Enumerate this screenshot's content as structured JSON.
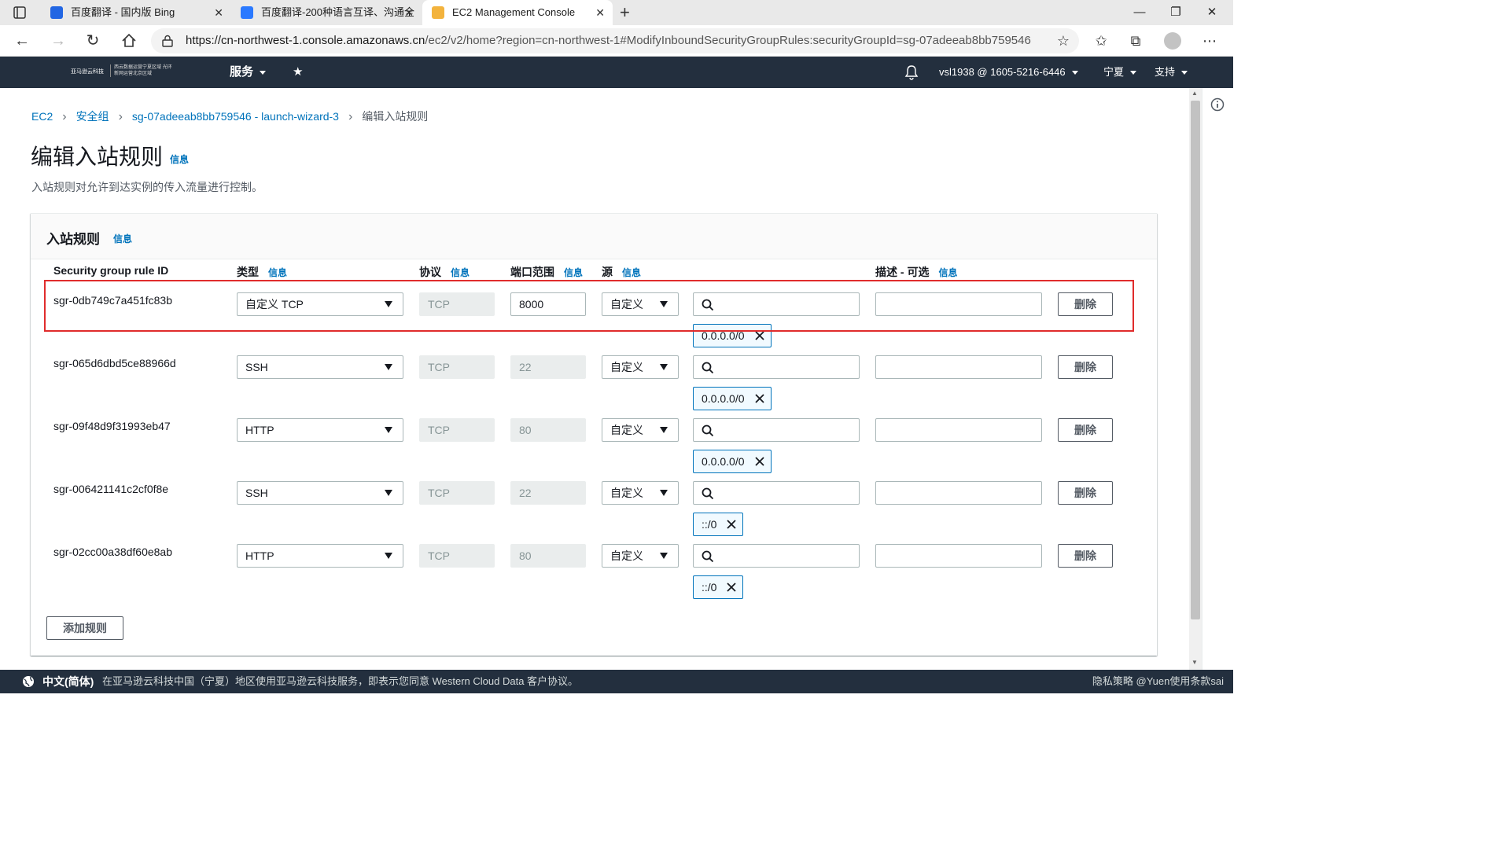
{
  "browser": {
    "tabs": [
      {
        "title": "百度翻译 - 国内版 Bing",
        "icon": "bing-icon",
        "color": "#2266e3"
      },
      {
        "title": "百度翻译-200种语言互译、沟通全",
        "icon": "baidu-translate-icon",
        "color": "#2a79ff"
      },
      {
        "title": "EC2 Management Console",
        "icon": "aws-icon",
        "color": "#f3b33d"
      }
    ],
    "url_host": "https://cn-northwest-1.console.amazonaws.cn",
    "url_path": "/ec2/v2/home?region=cn-northwest-1#ModifyInboundSecurityGroupRules:securityGroupId=sg-07adeeab8bb759546"
  },
  "aws_nav": {
    "logo_text": "亚马逊云科技",
    "logo_sub": "西云数据运营宁夏区域 光环新网运营北京区域",
    "services": "服务",
    "account": "vsl1938 @ 1605-5216-6446",
    "region": "宁夏",
    "support": "支持"
  },
  "breadcrumb": {
    "items": [
      "EC2",
      "安全组",
      "sg-07adeeab8bb759546 - launch-wizard-3"
    ],
    "current": "编辑入站规则"
  },
  "page": {
    "title": "编辑入站规则",
    "info": "信息",
    "description": "入站规则对允许到达实例的传入流量进行控制。"
  },
  "panel": {
    "title": "入站规则",
    "info": "信息",
    "columns": {
      "rule_id": "Security group rule ID",
      "type": "类型",
      "protocol": "协议",
      "port": "端口范围",
      "source": "源",
      "description": "描述 - 可选",
      "info": "信息"
    },
    "rules": [
      {
        "id": "sgr-0db749c7a451fc83b",
        "type": "自定义 TCP",
        "protocol": "TCP",
        "port": "8000",
        "port_editable": true,
        "source": "自定义",
        "cidr": "0.0.0.0/0",
        "delete": "删除"
      },
      {
        "id": "sgr-065d6dbd5ce88966d",
        "type": "SSH",
        "protocol": "TCP",
        "port": "22",
        "port_editable": false,
        "source": "自定义",
        "cidr": "0.0.0.0/0",
        "delete": "删除"
      },
      {
        "id": "sgr-09f48d9f31993eb47",
        "type": "HTTP",
        "protocol": "TCP",
        "port": "80",
        "port_editable": false,
        "source": "自定义",
        "cidr": "0.0.0.0/0",
        "delete": "删除"
      },
      {
        "id": "sgr-006421141c2cf0f8e",
        "type": "SSH",
        "protocol": "TCP",
        "port": "22",
        "port_editable": false,
        "source": "自定义",
        "cidr": "::/0",
        "delete": "删除"
      },
      {
        "id": "sgr-02cc00a38df60e8ab",
        "type": "HTTP",
        "protocol": "TCP",
        "port": "80",
        "port_editable": false,
        "source": "自定义",
        "cidr": "::/0",
        "delete": "删除"
      }
    ],
    "add_rule": "添加规则"
  },
  "footer": {
    "language": "中文(简体)",
    "text": "在亚马逊云科技中国（宁夏）地区使用亚马逊云科技服务，即表示您同意 Western Cloud Data 客户协议。",
    "right": "隐私策略 @Yuen使用条款sai"
  },
  "colors": {
    "nav_bg": "#232f3e",
    "link": "#0073bb",
    "highlight": "#e02c2c"
  }
}
